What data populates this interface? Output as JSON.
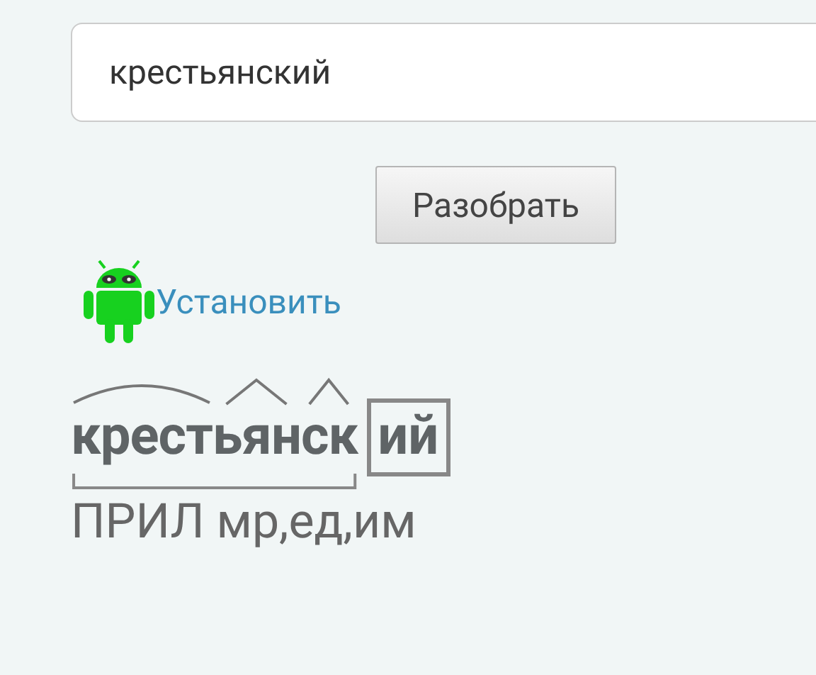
{
  "search": {
    "value": "крестьянский"
  },
  "parse_button": "Разобрать",
  "install_link": "Установить",
  "parse": {
    "stem": [
      {
        "kind": "root",
        "text": "крест"
      },
      {
        "kind": "suffix",
        "text": "ьян"
      },
      {
        "kind": "suffix",
        "text": "ск"
      }
    ],
    "ending": {
      "kind": "ending",
      "text": "ий"
    }
  },
  "grammar": "ПРИЛ мр,ед,им"
}
